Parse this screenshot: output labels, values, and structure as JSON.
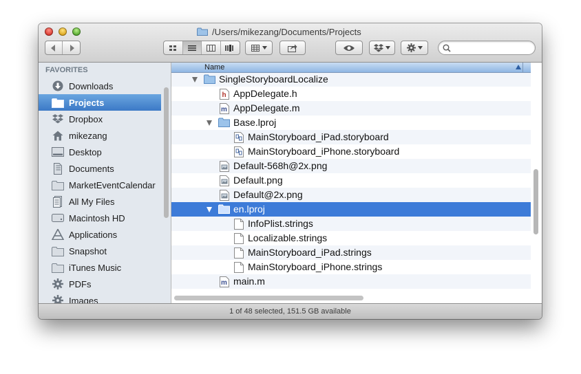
{
  "window": {
    "title": "/Users/mikezang/Documents/Projects"
  },
  "toolbar": {
    "icons": [
      "back-icon",
      "forward-icon",
      "icon-view-icon",
      "list-view-icon",
      "column-view-icon",
      "cover-flow-icon",
      "arrange-icon",
      "share-icon",
      "quick-look-icon",
      "dropbox-icon",
      "gear-icon",
      "search-icon"
    ],
    "search_placeholder": ""
  },
  "sidebar": {
    "header": "FAVORITES",
    "items": [
      {
        "label": "Downloads",
        "icon": "downloads-icon"
      },
      {
        "label": "Projects",
        "icon": "folder-icon",
        "selected": true
      },
      {
        "label": "Dropbox",
        "icon": "dropbox-icon"
      },
      {
        "label": "mikezang",
        "icon": "home-icon"
      },
      {
        "label": "Desktop",
        "icon": "desktop-icon"
      },
      {
        "label": "Documents",
        "icon": "documents-icon"
      },
      {
        "label": "MarketEventCalendar",
        "icon": "folder-icon"
      },
      {
        "label": "All My Files",
        "icon": "all-files-icon"
      },
      {
        "label": "Macintosh HD",
        "icon": "hard-drive-icon"
      },
      {
        "label": "Applications",
        "icon": "applications-icon"
      },
      {
        "label": "Snapshot",
        "icon": "folder-icon"
      },
      {
        "label": "iTunes Music",
        "icon": "folder-icon"
      },
      {
        "label": "PDFs",
        "icon": "gear-folder-icon"
      },
      {
        "label": "Images",
        "icon": "gear-folder-icon"
      }
    ]
  },
  "list": {
    "column_header": "Name",
    "rows": [
      {
        "name": "SingleStoryboardLocalize",
        "type": "folder",
        "level": 0,
        "expanded": true
      },
      {
        "name": "AppDelegate.h",
        "type": "h-file",
        "level": 1
      },
      {
        "name": "AppDelegate.m",
        "type": "m-file",
        "level": 1
      },
      {
        "name": "Base.lproj",
        "type": "folder",
        "level": 1,
        "expanded": true
      },
      {
        "name": "MainStoryboard_iPad.storyboard",
        "type": "storyboard",
        "level": 2
      },
      {
        "name": "MainStoryboard_iPhone.storyboard",
        "type": "storyboard",
        "level": 2
      },
      {
        "name": "Default-568h@2x.png",
        "type": "png",
        "level": 1
      },
      {
        "name": "Default.png",
        "type": "png",
        "level": 1
      },
      {
        "name": "Default@2x.png",
        "type": "png",
        "level": 1
      },
      {
        "name": "en.lproj",
        "type": "folder",
        "level": 1,
        "expanded": true,
        "selected": true
      },
      {
        "name": "InfoPlist.strings",
        "type": "text",
        "level": 2
      },
      {
        "name": "Localizable.strings",
        "type": "text",
        "level": 2
      },
      {
        "name": "MainStoryboard_iPad.strings",
        "type": "text",
        "level": 2
      },
      {
        "name": "MainStoryboard_iPhone.strings",
        "type": "text",
        "level": 2
      },
      {
        "name": "main.m",
        "type": "m-file",
        "level": 1
      }
    ]
  },
  "status": {
    "text": "1 of 48 selected, 151.5 GB available"
  },
  "colors": {
    "selection": "#3d7bd8",
    "sidebar_bg": "#e3e8ee",
    "header_blue": "#8fb6e3"
  }
}
